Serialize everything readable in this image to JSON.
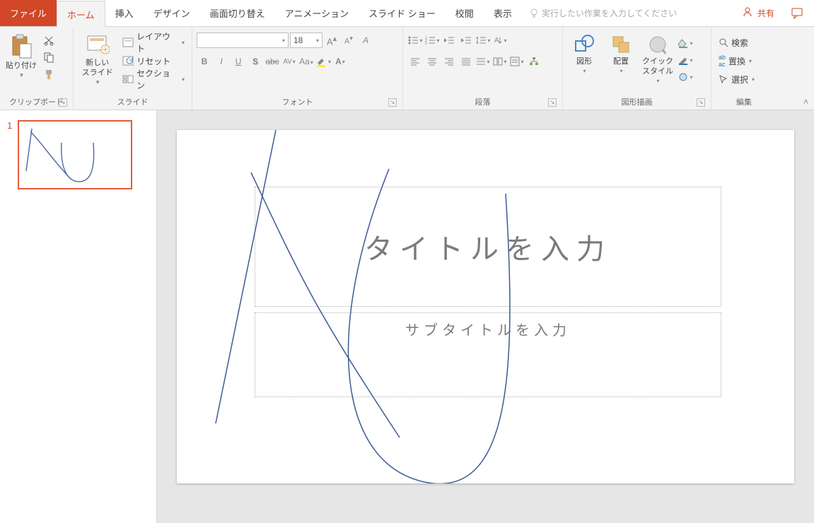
{
  "tabs": {
    "file": "ファイル",
    "home": "ホーム",
    "insert": "挿入",
    "design": "デザイン",
    "transitions": "画面切り替え",
    "animations": "アニメーション",
    "slideshow": "スライド ショー",
    "review": "校閲",
    "view": "表示"
  },
  "tellme_placeholder": "実行したい作業を入力してください",
  "share": "共有",
  "ribbon": {
    "clipboard": {
      "paste": "貼り付け",
      "label": "クリップボード"
    },
    "slides": {
      "newslide": "新しい\nスライド",
      "layout": "レイアウト",
      "reset": "リセット",
      "section": "セクション",
      "label": "スライド"
    },
    "font": {
      "size": "18",
      "label": "フォント"
    },
    "para": {
      "label": "段落"
    },
    "drawing": {
      "shapes": "図形",
      "arrange": "配置",
      "quickstyle": "クイック\nスタイル",
      "label": "図形描画"
    },
    "editing": {
      "find": "検索",
      "replace": "置換",
      "select": "選択",
      "label": "編集"
    }
  },
  "thumb": {
    "num": "1"
  },
  "slide": {
    "title_placeholder": "タイトルを入力",
    "subtitle_placeholder": "サブタイトルを入力"
  }
}
